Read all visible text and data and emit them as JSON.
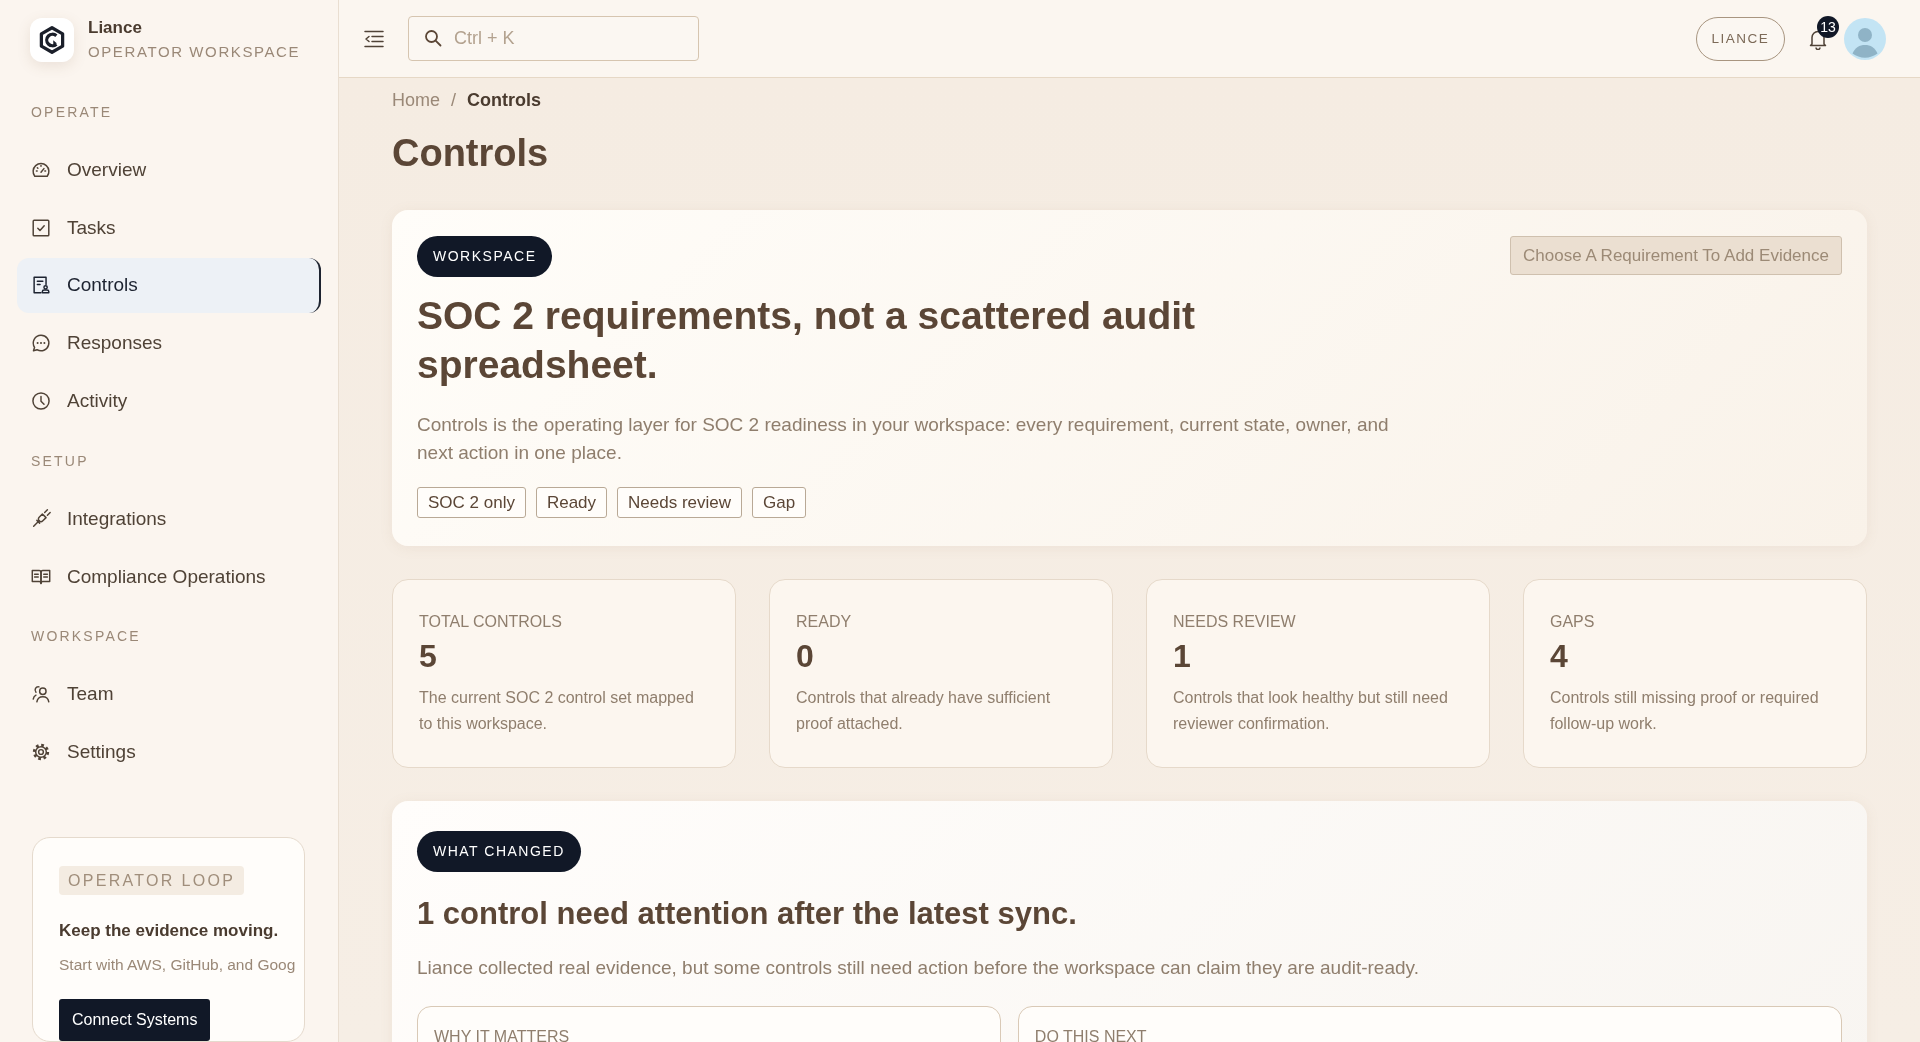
{
  "sidebar": {
    "brand": {
      "name": "Liance",
      "subtitle": "OPERATOR WORKSPACE"
    },
    "sections": [
      {
        "title": "OPERATE",
        "items": [
          {
            "label": "Overview",
            "selected": false
          },
          {
            "label": "Tasks",
            "selected": false
          },
          {
            "label": "Controls",
            "selected": true
          },
          {
            "label": "Responses",
            "selected": false
          },
          {
            "label": "Activity",
            "selected": false
          }
        ]
      },
      {
        "title": "SETUP",
        "items": [
          {
            "label": "Integrations",
            "selected": false
          },
          {
            "label": "Compliance Operations",
            "selected": false
          }
        ]
      },
      {
        "title": "WORKSPACE",
        "items": [
          {
            "label": "Team",
            "selected": false
          },
          {
            "label": "Settings",
            "selected": false
          }
        ]
      }
    ],
    "promo": {
      "tag": "OPERATOR LOOP",
      "title": "Keep the evidence moving.",
      "text": "Start with AWS, GitHub, and Goog",
      "button": "Connect Systems"
    }
  },
  "topbar": {
    "search": {
      "placeholder": "Ctrl + K"
    },
    "workspace_button": "LIANCE",
    "notification_count": "13"
  },
  "breadcrumb": {
    "separator": "/",
    "items": [
      {
        "label": "Home",
        "current": false
      },
      {
        "label": "Controls",
        "current": true
      }
    ]
  },
  "page_title": "Controls",
  "hero": {
    "tag": "WORKSPACE",
    "action": {
      "label": "Choose A Requirement To Add Evidence",
      "disabled": true
    },
    "title": "SOC 2 requirements, not a scattered audit spreadsheet.",
    "description": "Controls is the operating layer for SOC 2 readiness in your workspace: every requirement, current state, owner, and next action in one place.",
    "filters": [
      "SOC 2 only",
      "Ready",
      "Needs review",
      "Gap"
    ]
  },
  "stats": [
    {
      "label": "TOTAL CONTROLS",
      "value": "5",
      "description": "The current SOC 2 control set mapped to this workspace."
    },
    {
      "label": "READY",
      "value": "0",
      "description": "Controls that already have sufficient proof attached."
    },
    {
      "label": "NEEDS REVIEW",
      "value": "1",
      "description": "Controls that look healthy but still need reviewer confirmation."
    },
    {
      "label": "GAPS",
      "value": "4",
      "description": "Controls still missing proof or required follow-up work."
    }
  ],
  "what_changed": {
    "tag": "WHAT CHANGED",
    "title": "1 control need attention after the latest sync.",
    "description": "Liance collected real evidence, but some controls still need action before the workspace can claim they are audit-ready.",
    "panels": [
      {
        "title": "WHY IT MATTERS"
      },
      {
        "title": "DO THIS NEXT"
      }
    ]
  }
}
